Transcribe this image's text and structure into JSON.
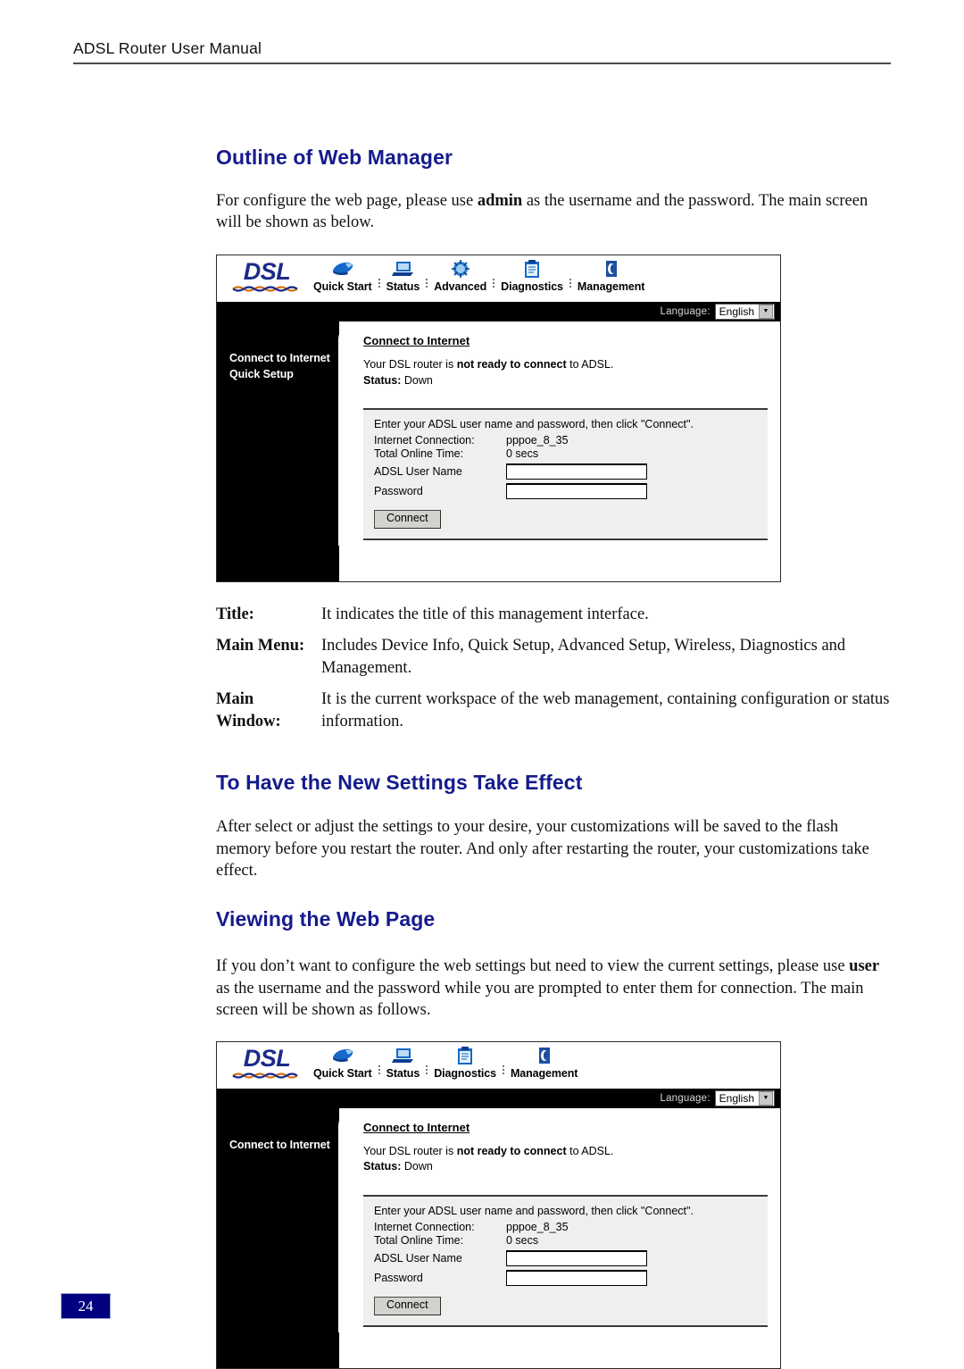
{
  "header": {
    "running_title": "ADSL Router User Manual"
  },
  "sections": {
    "outline": {
      "heading": "Outline of Web Manager",
      "para_before": "For configure the web page, please use ",
      "para_bold": "admin",
      "para_after": " as the username and the password. The main screen will be shown as below."
    },
    "effect": {
      "heading": "To Have the New Settings Take Effect",
      "para": "After select or adjust the settings to your desire, your customizations will be saved to the flash memory before you restart the router. And only after restarting the router, your customizations take effect."
    },
    "viewing": {
      "heading": "Viewing the Web Page",
      "para_before": "If you don’t want to configure the web settings but need to view the current settings, please use ",
      "para_bold": "user",
      "para_after": " as the username and the password while you are prompted to enter them for connection. The main screen will be shown as follows."
    }
  },
  "definitions": [
    {
      "term": "Title",
      "colon": ":",
      "desc": "It indicates the title of this management interface."
    },
    {
      "term": "Main Menu",
      "colon": ":",
      "desc": "Includes Device Info, Quick Setup, Advanced Setup, Wireless, Diagnostics and Management."
    },
    {
      "term": "Main\nWindow",
      "colon": ":",
      "desc": "It is the current workspace of the web management, containing configuration or status information."
    }
  ],
  "screenshot_admin": {
    "logo": {
      "word": "DSL",
      "chain_icon": "braided-chain-icon"
    },
    "nav": [
      {
        "label": "Quick Start",
        "icon": "mouse-pointer-icon"
      },
      {
        "label": "Status",
        "icon": "laptop-icon"
      },
      {
        "label": "Advanced",
        "icon": "gear-burst-icon"
      },
      {
        "label": "Diagnostics",
        "icon": "clipboard-icon"
      },
      {
        "label": "Management",
        "icon": "folder-box-icon"
      }
    ],
    "language": {
      "label": "Language:",
      "value": "English",
      "arrow": "▼"
    },
    "sidebar": [
      "Connect to Internet",
      "Quick Setup"
    ],
    "main": {
      "title": "Connect to Internet",
      "status_prefix": "Your DSL router is ",
      "status_bold": "not ready to connect",
      "status_suffix": " to ADSL.",
      "status_label": "Status:",
      "status_value": "Down"
    },
    "panel": {
      "hint": "Enter your ADSL user name and password, then click \"Connect\".",
      "rows": [
        {
          "key": "Internet Connection:",
          "value": "pppoe_8_35"
        },
        {
          "key": "Total Online Time:",
          "value": "0 secs"
        }
      ],
      "fields": [
        {
          "label": "ADSL User Name",
          "value": ""
        },
        {
          "label": "Password",
          "value": ""
        }
      ],
      "button": "Connect"
    }
  },
  "screenshot_user": {
    "logo": {
      "word": "DSL",
      "chain_icon": "braided-chain-icon"
    },
    "nav": [
      {
        "label": "Quick Start",
        "icon": "mouse-pointer-icon"
      },
      {
        "label": "Status",
        "icon": "laptop-icon"
      },
      {
        "label": "Diagnostics",
        "icon": "clipboard-icon"
      },
      {
        "label": "Management",
        "icon": "folder-box-icon"
      }
    ],
    "language": {
      "label": "Language:",
      "value": "English",
      "arrow": "▼"
    },
    "sidebar": [
      "Connect to Internet"
    ],
    "main": {
      "title": "Connect to Internet",
      "status_prefix": "Your DSL router is ",
      "status_bold": "not ready to connect",
      "status_suffix": " to ADSL.",
      "status_label": "Status:",
      "status_value": "Down"
    },
    "panel": {
      "hint": "Enter your ADSL user name and password, then click \"Connect\".",
      "rows": [
        {
          "key": "Internet Connection:",
          "value": "pppoe_8_35"
        },
        {
          "key": "Total Online Time:",
          "value": "0 secs"
        }
      ],
      "fields": [
        {
          "label": "ADSL User Name",
          "value": ""
        },
        {
          "label": "Password",
          "value": ""
        }
      ],
      "button": "Connect"
    }
  },
  "footer": {
    "page_number": "24"
  },
  "colors": {
    "heading": "#151b8d",
    "page_number_bg": "#000080",
    "logo": "#1c2a8a",
    "nav_icon": "#1569c7",
    "panel_bg": "#eef0ee"
  }
}
